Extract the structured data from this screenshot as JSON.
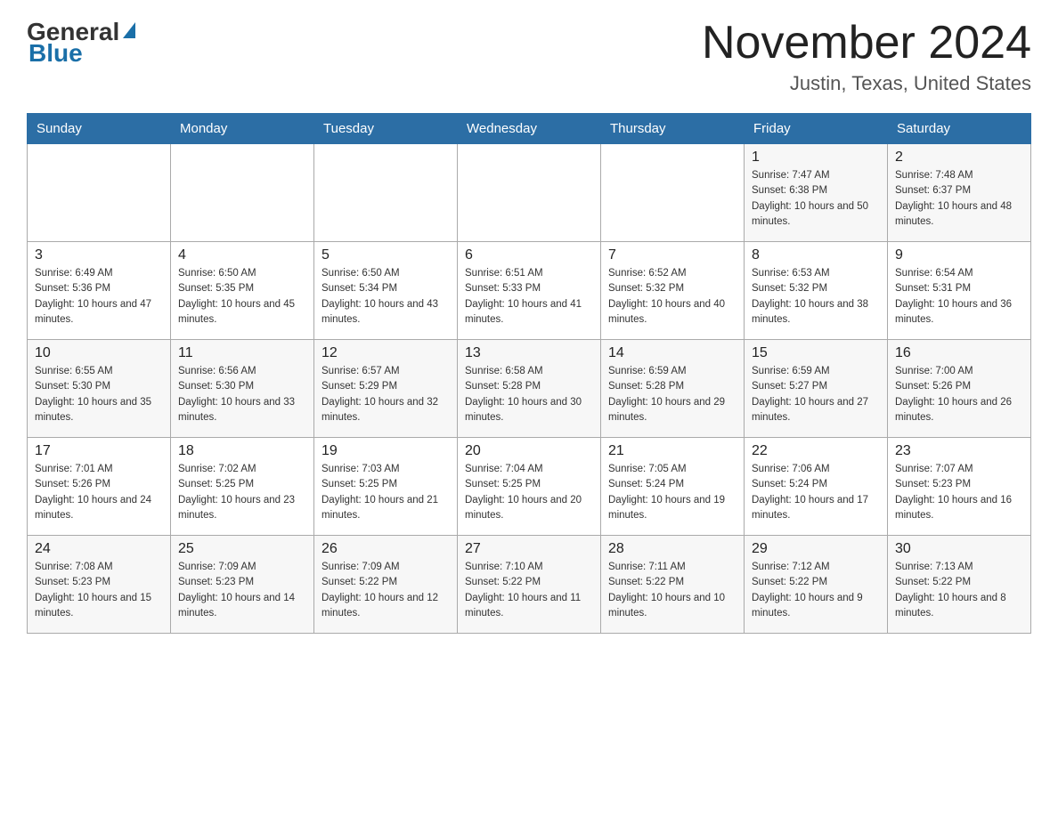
{
  "logo": {
    "general": "General",
    "blue": "Blue"
  },
  "header": {
    "month_year": "November 2024",
    "location": "Justin, Texas, United States"
  },
  "weekdays": [
    "Sunday",
    "Monday",
    "Tuesday",
    "Wednesday",
    "Thursday",
    "Friday",
    "Saturday"
  ],
  "weeks": [
    [
      {
        "day": "",
        "sunrise": "",
        "sunset": "",
        "daylight": ""
      },
      {
        "day": "",
        "sunrise": "",
        "sunset": "",
        "daylight": ""
      },
      {
        "day": "",
        "sunrise": "",
        "sunset": "",
        "daylight": ""
      },
      {
        "day": "",
        "sunrise": "",
        "sunset": "",
        "daylight": ""
      },
      {
        "day": "",
        "sunrise": "",
        "sunset": "",
        "daylight": ""
      },
      {
        "day": "1",
        "sunrise": "Sunrise: 7:47 AM",
        "sunset": "Sunset: 6:38 PM",
        "daylight": "Daylight: 10 hours and 50 minutes."
      },
      {
        "day": "2",
        "sunrise": "Sunrise: 7:48 AM",
        "sunset": "Sunset: 6:37 PM",
        "daylight": "Daylight: 10 hours and 48 minutes."
      }
    ],
    [
      {
        "day": "3",
        "sunrise": "Sunrise: 6:49 AM",
        "sunset": "Sunset: 5:36 PM",
        "daylight": "Daylight: 10 hours and 47 minutes."
      },
      {
        "day": "4",
        "sunrise": "Sunrise: 6:50 AM",
        "sunset": "Sunset: 5:35 PM",
        "daylight": "Daylight: 10 hours and 45 minutes."
      },
      {
        "day": "5",
        "sunrise": "Sunrise: 6:50 AM",
        "sunset": "Sunset: 5:34 PM",
        "daylight": "Daylight: 10 hours and 43 minutes."
      },
      {
        "day": "6",
        "sunrise": "Sunrise: 6:51 AM",
        "sunset": "Sunset: 5:33 PM",
        "daylight": "Daylight: 10 hours and 41 minutes."
      },
      {
        "day": "7",
        "sunrise": "Sunrise: 6:52 AM",
        "sunset": "Sunset: 5:32 PM",
        "daylight": "Daylight: 10 hours and 40 minutes."
      },
      {
        "day": "8",
        "sunrise": "Sunrise: 6:53 AM",
        "sunset": "Sunset: 5:32 PM",
        "daylight": "Daylight: 10 hours and 38 minutes."
      },
      {
        "day": "9",
        "sunrise": "Sunrise: 6:54 AM",
        "sunset": "Sunset: 5:31 PM",
        "daylight": "Daylight: 10 hours and 36 minutes."
      }
    ],
    [
      {
        "day": "10",
        "sunrise": "Sunrise: 6:55 AM",
        "sunset": "Sunset: 5:30 PM",
        "daylight": "Daylight: 10 hours and 35 minutes."
      },
      {
        "day": "11",
        "sunrise": "Sunrise: 6:56 AM",
        "sunset": "Sunset: 5:30 PM",
        "daylight": "Daylight: 10 hours and 33 minutes."
      },
      {
        "day": "12",
        "sunrise": "Sunrise: 6:57 AM",
        "sunset": "Sunset: 5:29 PM",
        "daylight": "Daylight: 10 hours and 32 minutes."
      },
      {
        "day": "13",
        "sunrise": "Sunrise: 6:58 AM",
        "sunset": "Sunset: 5:28 PM",
        "daylight": "Daylight: 10 hours and 30 minutes."
      },
      {
        "day": "14",
        "sunrise": "Sunrise: 6:59 AM",
        "sunset": "Sunset: 5:28 PM",
        "daylight": "Daylight: 10 hours and 29 minutes."
      },
      {
        "day": "15",
        "sunrise": "Sunrise: 6:59 AM",
        "sunset": "Sunset: 5:27 PM",
        "daylight": "Daylight: 10 hours and 27 minutes."
      },
      {
        "day": "16",
        "sunrise": "Sunrise: 7:00 AM",
        "sunset": "Sunset: 5:26 PM",
        "daylight": "Daylight: 10 hours and 26 minutes."
      }
    ],
    [
      {
        "day": "17",
        "sunrise": "Sunrise: 7:01 AM",
        "sunset": "Sunset: 5:26 PM",
        "daylight": "Daylight: 10 hours and 24 minutes."
      },
      {
        "day": "18",
        "sunrise": "Sunrise: 7:02 AM",
        "sunset": "Sunset: 5:25 PM",
        "daylight": "Daylight: 10 hours and 23 minutes."
      },
      {
        "day": "19",
        "sunrise": "Sunrise: 7:03 AM",
        "sunset": "Sunset: 5:25 PM",
        "daylight": "Daylight: 10 hours and 21 minutes."
      },
      {
        "day": "20",
        "sunrise": "Sunrise: 7:04 AM",
        "sunset": "Sunset: 5:25 PM",
        "daylight": "Daylight: 10 hours and 20 minutes."
      },
      {
        "day": "21",
        "sunrise": "Sunrise: 7:05 AM",
        "sunset": "Sunset: 5:24 PM",
        "daylight": "Daylight: 10 hours and 19 minutes."
      },
      {
        "day": "22",
        "sunrise": "Sunrise: 7:06 AM",
        "sunset": "Sunset: 5:24 PM",
        "daylight": "Daylight: 10 hours and 17 minutes."
      },
      {
        "day": "23",
        "sunrise": "Sunrise: 7:07 AM",
        "sunset": "Sunset: 5:23 PM",
        "daylight": "Daylight: 10 hours and 16 minutes."
      }
    ],
    [
      {
        "day": "24",
        "sunrise": "Sunrise: 7:08 AM",
        "sunset": "Sunset: 5:23 PM",
        "daylight": "Daylight: 10 hours and 15 minutes."
      },
      {
        "day": "25",
        "sunrise": "Sunrise: 7:09 AM",
        "sunset": "Sunset: 5:23 PM",
        "daylight": "Daylight: 10 hours and 14 minutes."
      },
      {
        "day": "26",
        "sunrise": "Sunrise: 7:09 AM",
        "sunset": "Sunset: 5:22 PM",
        "daylight": "Daylight: 10 hours and 12 minutes."
      },
      {
        "day": "27",
        "sunrise": "Sunrise: 7:10 AM",
        "sunset": "Sunset: 5:22 PM",
        "daylight": "Daylight: 10 hours and 11 minutes."
      },
      {
        "day": "28",
        "sunrise": "Sunrise: 7:11 AM",
        "sunset": "Sunset: 5:22 PM",
        "daylight": "Daylight: 10 hours and 10 minutes."
      },
      {
        "day": "29",
        "sunrise": "Sunrise: 7:12 AM",
        "sunset": "Sunset: 5:22 PM",
        "daylight": "Daylight: 10 hours and 9 minutes."
      },
      {
        "day": "30",
        "sunrise": "Sunrise: 7:13 AM",
        "sunset": "Sunset: 5:22 PM",
        "daylight": "Daylight: 10 hours and 8 minutes."
      }
    ]
  ]
}
